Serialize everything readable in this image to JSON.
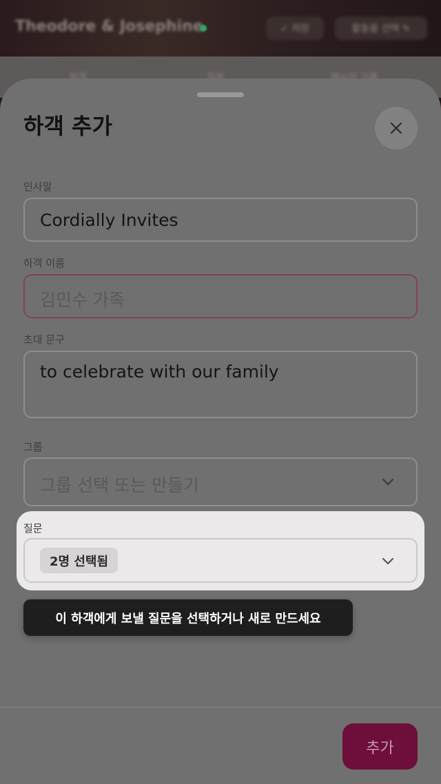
{
  "background": {
    "title": "Theodore & Josephine",
    "edit_label": "✓ 저장",
    "select_label": "활동을 선택 ✎",
    "tabs": [
      "하객",
      "질문",
      "메시지 기록"
    ]
  },
  "sheet": {
    "title": "하객 추가",
    "fields": {
      "greeting": {
        "label": "인사말",
        "value": "Cordially Invites"
      },
      "guest_name": {
        "label": "하객 이름",
        "placeholder": "김민수 가족"
      },
      "invitation": {
        "label": "초대 문구",
        "value": "to celebrate with our family"
      },
      "group": {
        "label": "그룹",
        "placeholder": "그룹 선택 또는 만들기"
      },
      "questions": {
        "label": "질문",
        "selected_chip": "2명 선택됨"
      }
    },
    "tooltip": "이 하객에게 보낼 질문을 선택하거나 새로 만드세요",
    "add_button": "추가"
  },
  "colors": {
    "accent": "#c2185b",
    "error_border": "#e57399",
    "tooltip_bg": "#1e1e1e"
  },
  "icons": {
    "close": "close-icon",
    "chevron": "chevron-down-icon"
  }
}
